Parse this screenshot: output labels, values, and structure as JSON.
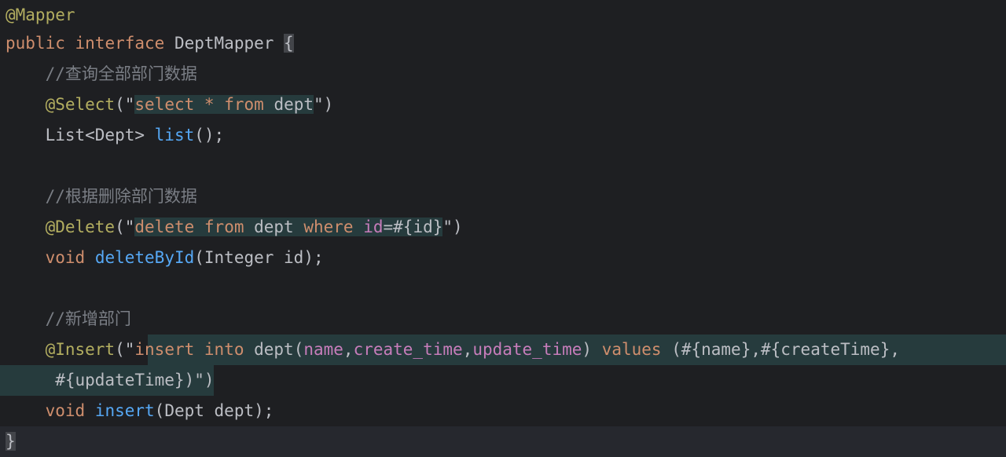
{
  "editor": {
    "lines": [
      {
        "id": "l1",
        "segments": [
          {
            "t": "@Mapper",
            "c": "ann"
          }
        ]
      },
      {
        "id": "l2",
        "segments": [
          {
            "t": "public",
            "c": "kw"
          },
          {
            "t": " ",
            "c": "plain"
          },
          {
            "t": "interface",
            "c": "kw"
          },
          {
            "t": " DeptMapper ",
            "c": "plain"
          },
          {
            "t": "{",
            "c": "plain brace"
          }
        ]
      },
      {
        "id": "l3",
        "segments": [
          {
            "t": "    //查询全部部门数据",
            "c": "cm"
          }
        ]
      },
      {
        "id": "l4",
        "segments": [
          {
            "t": "    ",
            "c": "plain"
          },
          {
            "t": "@Select",
            "c": "ann"
          },
          {
            "t": "(\"",
            "c": "plain"
          },
          {
            "t": "select",
            "c": "kw sql"
          },
          {
            "t": " ",
            "c": "plain sql"
          },
          {
            "t": "*",
            "c": "kw sql"
          },
          {
            "t": " ",
            "c": "plain sql"
          },
          {
            "t": "from",
            "c": "kw sql"
          },
          {
            "t": " dept",
            "c": "plain sql"
          },
          {
            "t": "\")",
            "c": "plain"
          }
        ]
      },
      {
        "id": "l5",
        "segments": [
          {
            "t": "    List<Dept> ",
            "c": "plain"
          },
          {
            "t": "list",
            "c": "fn"
          },
          {
            "t": "();",
            "c": "plain"
          }
        ]
      },
      {
        "id": "l6",
        "segments": []
      },
      {
        "id": "l7",
        "segments": [
          {
            "t": "    //根据删除部门数据",
            "c": "cm"
          }
        ]
      },
      {
        "id": "l8",
        "segments": [
          {
            "t": "    ",
            "c": "plain"
          },
          {
            "t": "@Delete",
            "c": "ann"
          },
          {
            "t": "(\"",
            "c": "plain"
          },
          {
            "t": "delete",
            "c": "kw sql"
          },
          {
            "t": " ",
            "c": "plain sql"
          },
          {
            "t": "from",
            "c": "kw sql"
          },
          {
            "t": " dept ",
            "c": "plain sql"
          },
          {
            "t": "where",
            "c": "kw sql"
          },
          {
            "t": " ",
            "c": "plain sql"
          },
          {
            "t": "id",
            "c": "col sql"
          },
          {
            "t": "=#{id}",
            "c": "plain sql"
          },
          {
            "t": "\")",
            "c": "plain"
          }
        ]
      },
      {
        "id": "l9",
        "segments": [
          {
            "t": "    ",
            "c": "plain"
          },
          {
            "t": "void",
            "c": "kw"
          },
          {
            "t": " ",
            "c": "plain"
          },
          {
            "t": "deleteById",
            "c": "fn"
          },
          {
            "t": "(Integer id);",
            "c": "plain"
          }
        ]
      },
      {
        "id": "l10",
        "segments": []
      },
      {
        "id": "l11",
        "segments": [
          {
            "t": "    //新增部门",
            "c": "cm"
          }
        ]
      },
      {
        "id": "l12",
        "segments": [
          {
            "t": "    ",
            "c": "plain"
          },
          {
            "t": "@Insert",
            "c": "ann"
          },
          {
            "t": "(\"",
            "c": "plain"
          },
          {
            "t": "insert",
            "c": "kw"
          },
          {
            "t": " ",
            "c": "plain"
          },
          {
            "t": "into",
            "c": "kw"
          },
          {
            "t": " dept(",
            "c": "plain"
          },
          {
            "t": "name",
            "c": "col"
          },
          {
            "t": ",",
            "c": "plain"
          },
          {
            "t": "create_time",
            "c": "col"
          },
          {
            "t": ",",
            "c": "plain"
          },
          {
            "t": "update_time",
            "c": "col"
          },
          {
            "t": ") ",
            "c": "plain"
          },
          {
            "t": "values",
            "c": "kw"
          },
          {
            "t": " (#{name},#{createTime},",
            "c": "plain"
          }
        ]
      },
      {
        "id": "l13",
        "segments": [
          {
            "t": "     #{updateTime})",
            "c": "plain"
          },
          {
            "t": "\")",
            "c": "plain"
          }
        ]
      },
      {
        "id": "l14",
        "segments": [
          {
            "t": "    ",
            "c": "plain"
          },
          {
            "t": "void",
            "c": "kw"
          },
          {
            "t": " ",
            "c": "plain"
          },
          {
            "t": "insert",
            "c": "fn"
          },
          {
            "t": "(Dept dept);",
            "c": "plain"
          }
        ]
      },
      {
        "id": "l15",
        "segments": [
          {
            "t": "}",
            "c": "plain caret-brace"
          }
        ]
      }
    ]
  }
}
